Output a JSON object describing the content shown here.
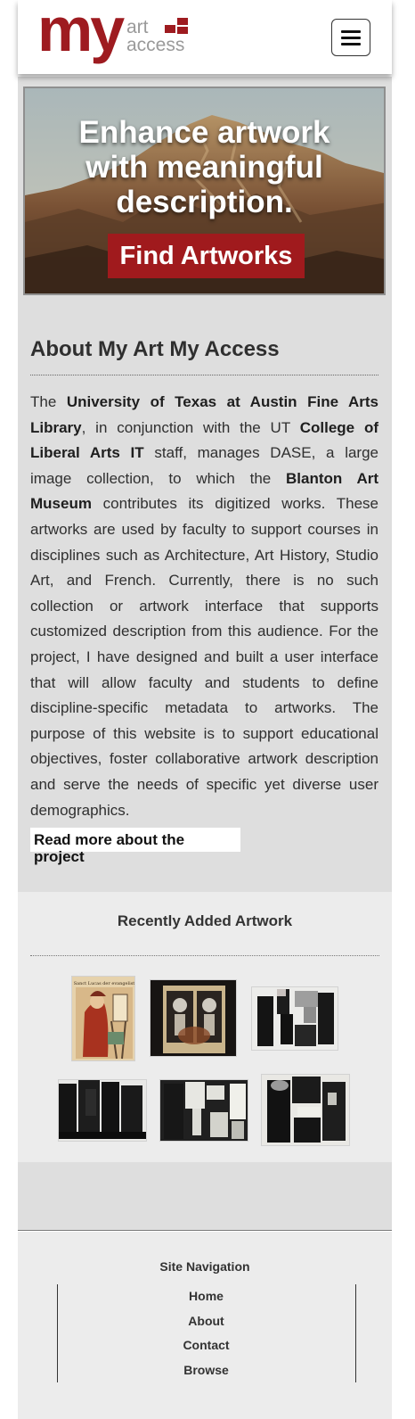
{
  "header": {
    "logo": {
      "my": "my",
      "art": "art",
      "access": "access",
      "brand_color": "#9e1b20"
    },
    "menu_icon": "hamburger-menu-icon"
  },
  "hero": {
    "headline_line1": "Enhance artwork",
    "headline_line2": "with meaningful",
    "headline_line3": "description.",
    "cta_label": "Find Artworks",
    "cta_color": "#a01a1d"
  },
  "about": {
    "title": "About My Art My Access",
    "body": {
      "t1": "The ",
      "b1": "University of Texas at Austin Fine Arts Library",
      "t2": ", in conjunction with the UT ",
      "b2": "College of Liberal Arts IT",
      "t3": " staff, manages DASE, a large image collection, to which the ",
      "b3": "Blanton Art Museum",
      "t4": " contributes its digitized works. These artworks are used by faculty to support courses in disciplines such as Architecture, Art History, Studio Art, and French. Currently, there is no such collection or artwork interface that supports customized description from this audience. For the project, I have designed and built a user interface that will allow faculty and students to define discipline-specific metadata to artworks. The purpose of this website is to support educational objectives, foster collaborative artwork description and serve the needs of specific yet diverse user demographics."
    },
    "read_more": "Read more about the project"
  },
  "recent": {
    "title": "Recently Added Artwork",
    "thumbnails": [
      {
        "id": "artwork-1",
        "text": "Sanct Lucas der evangelist"
      },
      {
        "id": "artwork-2",
        "text": ""
      },
      {
        "id": "artwork-3",
        "text": ""
      },
      {
        "id": "artwork-4",
        "text": ""
      },
      {
        "id": "artwork-5",
        "text": ""
      },
      {
        "id": "artwork-6",
        "text": ""
      }
    ]
  },
  "footer": {
    "title": "Site Navigation",
    "links": [
      "Home",
      "About",
      "Contact",
      "Browse"
    ]
  }
}
